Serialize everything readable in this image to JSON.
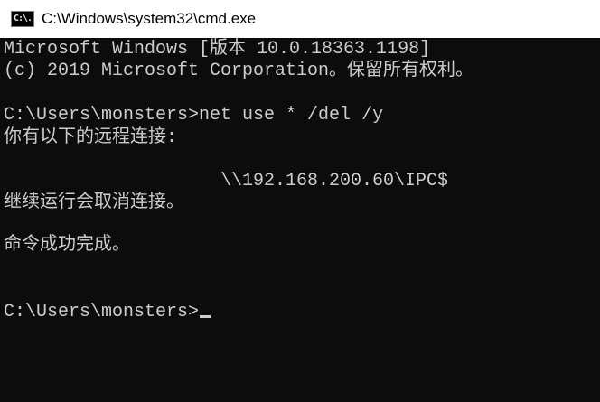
{
  "window": {
    "title": "C:\\Windows\\system32\\cmd.exe",
    "icon_label": "C:\\."
  },
  "console": {
    "lines": [
      "Microsoft Windows [版本 10.0.18363.1198]",
      "(c) 2019 Microsoft Corporation。保留所有权利。",
      "C:\\Users\\monsters>net use * /del /y",
      "你有以下的远程连接:",
      "\\\\192.168.200.60\\IPC$",
      "继续运行会取消连接。",
      "命令成功完成。",
      "C:\\Users\\monsters>"
    ]
  },
  "colors": {
    "background": "#0c0c0c",
    "foreground": "#cccccc",
    "titlebar": "#ffffff"
  },
  "icons": {
    "app": "cmd-prompt-icon"
  }
}
